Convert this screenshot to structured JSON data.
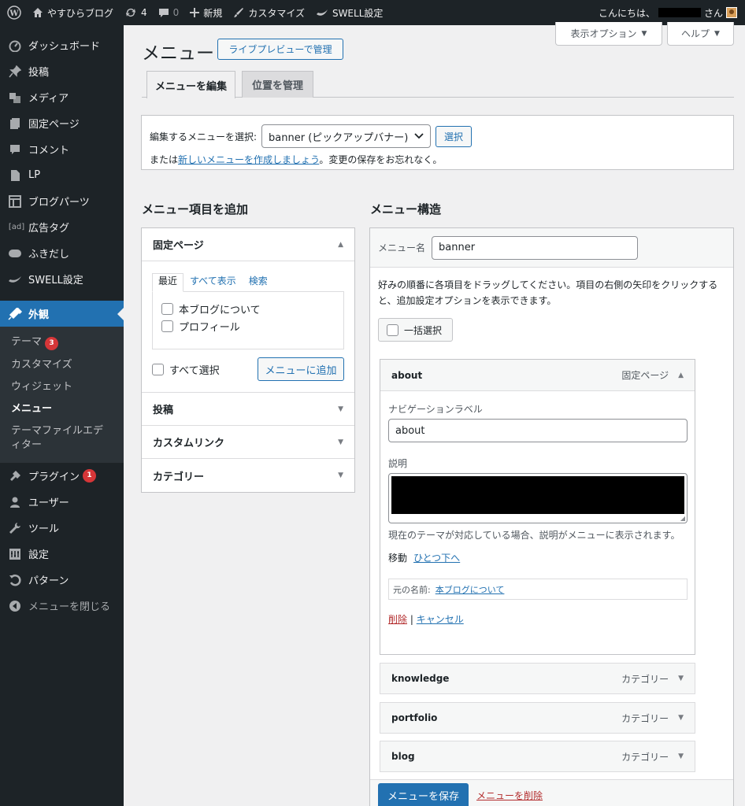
{
  "admin_bar": {
    "site_name": "やすひらブログ",
    "updates_count": "4",
    "comments_count": "0",
    "new_label": "新規",
    "customize_label": "カスタマイズ",
    "swell_label": "SWELL設定",
    "greeting_prefix": "こんにちは、",
    "greeting_suffix": "さん"
  },
  "sidebar": {
    "items": [
      {
        "label": "ダッシュボード",
        "icon": "dashboard-icon"
      },
      {
        "label": "投稿",
        "icon": "pin-icon"
      },
      {
        "label": "メディア",
        "icon": "media-icon"
      },
      {
        "label": "固定ページ",
        "icon": "page-icon"
      },
      {
        "label": "コメント",
        "icon": "comment-icon"
      },
      {
        "label": "LP",
        "icon": "file-icon"
      },
      {
        "label": "ブログパーツ",
        "icon": "layout-icon"
      },
      {
        "label": "広告タグ",
        "icon": "ad-icon"
      },
      {
        "label": "ふきだし",
        "icon": "speech-icon"
      },
      {
        "label": "SWELL設定",
        "icon": "swell-icon"
      },
      {
        "label": "外観",
        "icon": "brush-icon"
      }
    ],
    "submenu": [
      {
        "label": "テーマ",
        "badge": "3"
      },
      {
        "label": "カスタマイズ"
      },
      {
        "label": "ウィジェット"
      },
      {
        "label": "メニュー"
      },
      {
        "label": "テーマファイルエディター"
      }
    ],
    "items_after": [
      {
        "label": "プラグイン",
        "icon": "plugin-icon",
        "badge": "1"
      },
      {
        "label": "ユーザー",
        "icon": "user-icon"
      },
      {
        "label": "ツール",
        "icon": "wrench-icon"
      },
      {
        "label": "設定",
        "icon": "settings-icon"
      },
      {
        "label": "パターン",
        "icon": "undo-icon"
      }
    ],
    "collapse_label": "メニューを閉じる"
  },
  "screen_options": {
    "display_label": "表示オプション",
    "help_label": "ヘルプ"
  },
  "page": {
    "title": "メニュー",
    "live_preview_button": "ライブプレビューで管理",
    "tabs": [
      "メニューを編集",
      "位置を管理"
    ]
  },
  "select_menu": {
    "label": "編集するメニューを選択:",
    "selected": "banner (ピックアップバナー)",
    "select_button": "選択",
    "or_text": "または",
    "create_link": "新しいメニューを作成しましょう",
    "reminder": "。変更の保存をお忘れなく。"
  },
  "add_items": {
    "heading": "メニュー項目を追加",
    "pages_section": "固定ページ",
    "subtabs": [
      "最近",
      "すべて表示",
      "検索"
    ],
    "pages": [
      "本ブログについて",
      "プロフィール"
    ],
    "select_all": "すべて選択",
    "add_button": "メニューに追加",
    "sections": [
      "投稿",
      "カスタムリンク",
      "カテゴリー"
    ]
  },
  "structure": {
    "heading": "メニュー構造",
    "menu_name_label": "メニュー名",
    "menu_name_value": "banner",
    "instructions": "好みの順番に各項目をドラッグしてください。項目の右側の矢印をクリックすると、追加設定オプションを表示できます。",
    "bulk_select": "一括選択",
    "expanded_item": {
      "title": "about",
      "type": "固定ページ",
      "nav_label_label": "ナビゲーションラベル",
      "nav_label_value": "about",
      "description_label": "説明",
      "description_note": "現在のテーマが対応している場合、説明がメニューに表示されます。",
      "move_label": "移動",
      "move_link": "ひとつ下へ",
      "original_label": "元の名前:",
      "original_link": "本ブログについて",
      "delete_link": "削除",
      "separator": "|",
      "cancel_link": "キャンセル"
    },
    "items": [
      {
        "title": "knowledge",
        "type": "カテゴリー"
      },
      {
        "title": "portfolio",
        "type": "カテゴリー"
      },
      {
        "title": "blog",
        "type": "カテゴリー"
      }
    ],
    "save_button": "メニューを保存",
    "delete_menu_link": "メニューを削除"
  }
}
